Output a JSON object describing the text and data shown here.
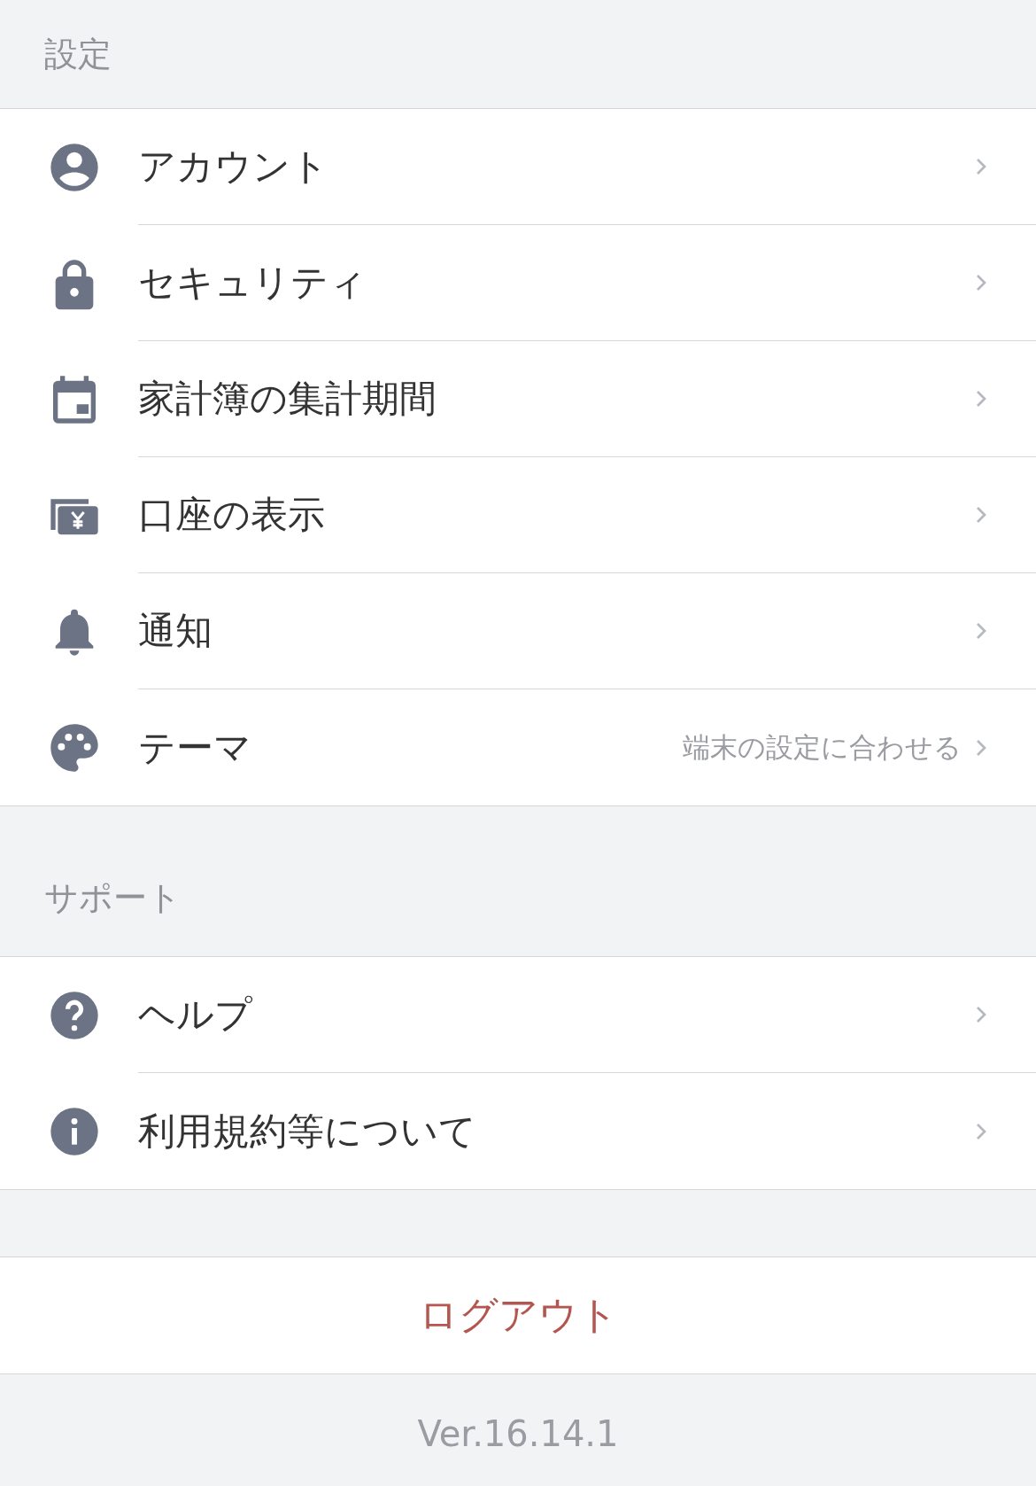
{
  "sections": [
    {
      "title": "設定",
      "items": [
        {
          "label": "アカウント"
        },
        {
          "label": "セキュリティ"
        },
        {
          "label": "家計簿の集計期間"
        },
        {
          "label": "口座の表示"
        },
        {
          "label": "通知"
        },
        {
          "label": "テーマ",
          "detail": "端末の設定に合わせる"
        }
      ]
    },
    {
      "title": "サポート",
      "items": [
        {
          "label": "ヘルプ"
        },
        {
          "label": "利用規約等について"
        }
      ]
    }
  ],
  "logout": {
    "label": "ログアウト"
  },
  "version": "Ver.16.14.1"
}
